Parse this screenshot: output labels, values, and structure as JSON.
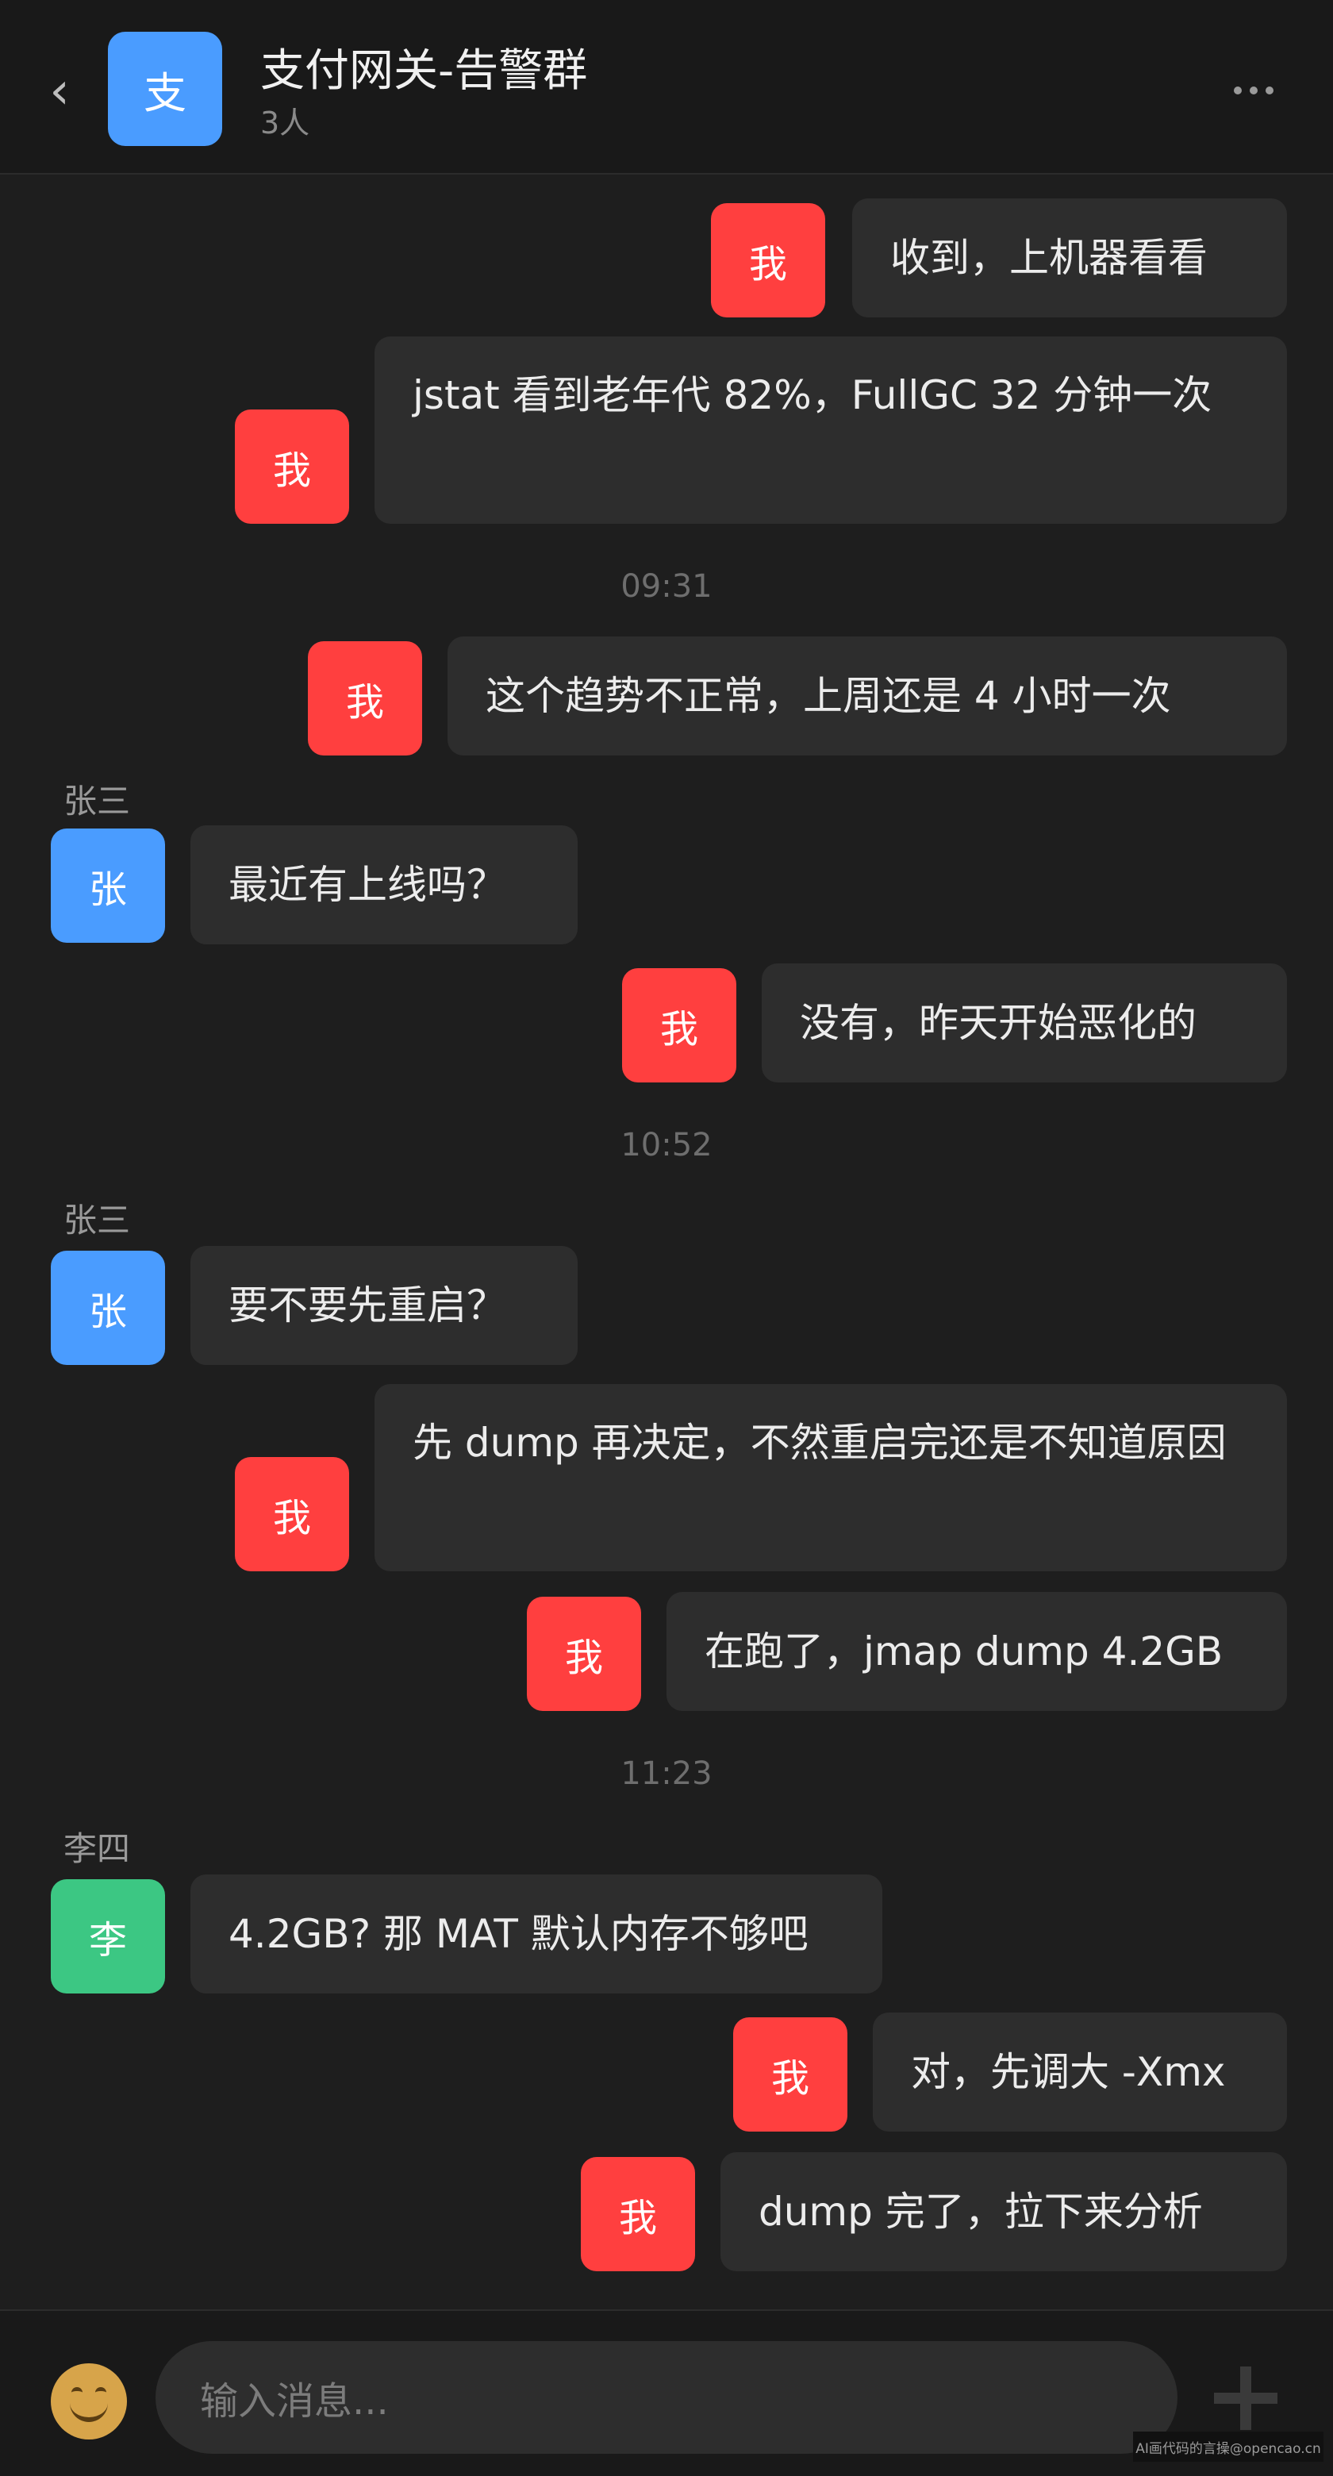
{
  "header": {
    "back_icon": "chevron-left-icon",
    "group_avatar_char": "支",
    "title": "支付网关-告警群",
    "member_count": "3人",
    "more_icon": "more-horizontal-icon"
  },
  "colors": {
    "background": "#1e1e1e",
    "bubble": "#2d2d2d",
    "me_avatar": "#ff3f3f",
    "zhang_avatar": "#4a9cff",
    "li_avatar": "#3cc783",
    "group_avatar": "#4a9cff"
  },
  "messages": [
    {
      "from": "me",
      "avatar": "我",
      "text": "收到，上机器看看"
    },
    {
      "from": "me",
      "avatar": "我",
      "text": "jstat 看到老年代 82%，FullGC 32 分钟一次"
    },
    {
      "type": "timestamp",
      "text": "09:31"
    },
    {
      "from": "me",
      "avatar": "我",
      "text": "这个趋势不正常，上周还是 4 小时一次"
    },
    {
      "from": "zhang",
      "sender": "张三",
      "avatar": "张",
      "text": "最近有上线吗？"
    },
    {
      "from": "me",
      "avatar": "我",
      "text": "没有，昨天开始恶化的"
    },
    {
      "type": "timestamp",
      "text": "10:52"
    },
    {
      "from": "zhang",
      "sender": "张三",
      "avatar": "张",
      "text": "要不要先重启？"
    },
    {
      "from": "me",
      "avatar": "我",
      "text": "先 dump 再决定，不然重启完还是不知道原因"
    },
    {
      "from": "me",
      "avatar": "我",
      "text": "在跑了，jmap dump 4.2GB"
    },
    {
      "type": "timestamp",
      "text": "11:23"
    },
    {
      "from": "li",
      "sender": "李四",
      "avatar": "李",
      "text": "4.2GB? 那 MAT 默认内存不够吧"
    },
    {
      "from": "me",
      "avatar": "我",
      "text": "对，先调大 -Xmx"
    },
    {
      "from": "me",
      "avatar": "我",
      "text": "dump 完了，拉下来分析"
    }
  ],
  "footer": {
    "emoji_icon": "emoji-smile-icon",
    "input_placeholder": "输入消息...",
    "plus_icon": "plus-icon"
  },
  "watermark": "AI画代码的言操@opencao.cn"
}
